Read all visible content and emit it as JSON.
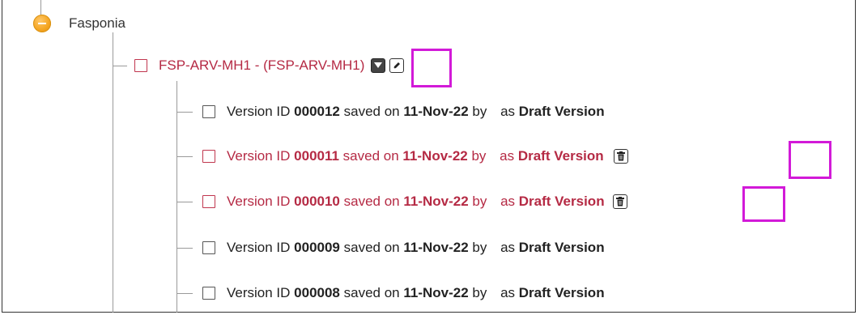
{
  "tree": {
    "root": {
      "label": "Fasponia"
    },
    "node": {
      "label": "FSP-ARV-MH1 - (FSP-ARV-MH1)"
    },
    "versions": [
      {
        "prefix": "Version ID ",
        "id": "000012",
        "saved_on": " saved on ",
        "date": "11-Nov-22",
        "by": " by ",
        "as": " as ",
        "type": "Draft Version",
        "selected": false
      },
      {
        "prefix": "Version ID ",
        "id": "000011",
        "saved_on": " saved on ",
        "date": "11-Nov-22",
        "by": " by ",
        "as": " as ",
        "type": "Draft Version",
        "selected": true
      },
      {
        "prefix": "Version ID ",
        "id": "000010",
        "saved_on": " saved on ",
        "date": "11-Nov-22",
        "by": " by ",
        "as": " as ",
        "type": "Draft Version",
        "selected": true
      },
      {
        "prefix": "Version ID ",
        "id": "000009",
        "saved_on": " saved on ",
        "date": "11-Nov-22",
        "by": " by ",
        "as": " as ",
        "type": "Draft Version",
        "selected": false
      },
      {
        "prefix": "Version ID ",
        "id": "000008",
        "saved_on": " saved on ",
        "date": "11-Nov-22",
        "by": " by ",
        "as": " as ",
        "type": "Draft Version",
        "selected": false
      }
    ]
  },
  "colors": {
    "selected_text": "#b52a44",
    "highlight": "#d21ad8",
    "toggle": "#f5a623"
  },
  "icons": {
    "toggle": "minus-circle-icon",
    "dropdown": "caret-down-icon",
    "edit": "edit-icon",
    "delete": "trash-icon"
  }
}
